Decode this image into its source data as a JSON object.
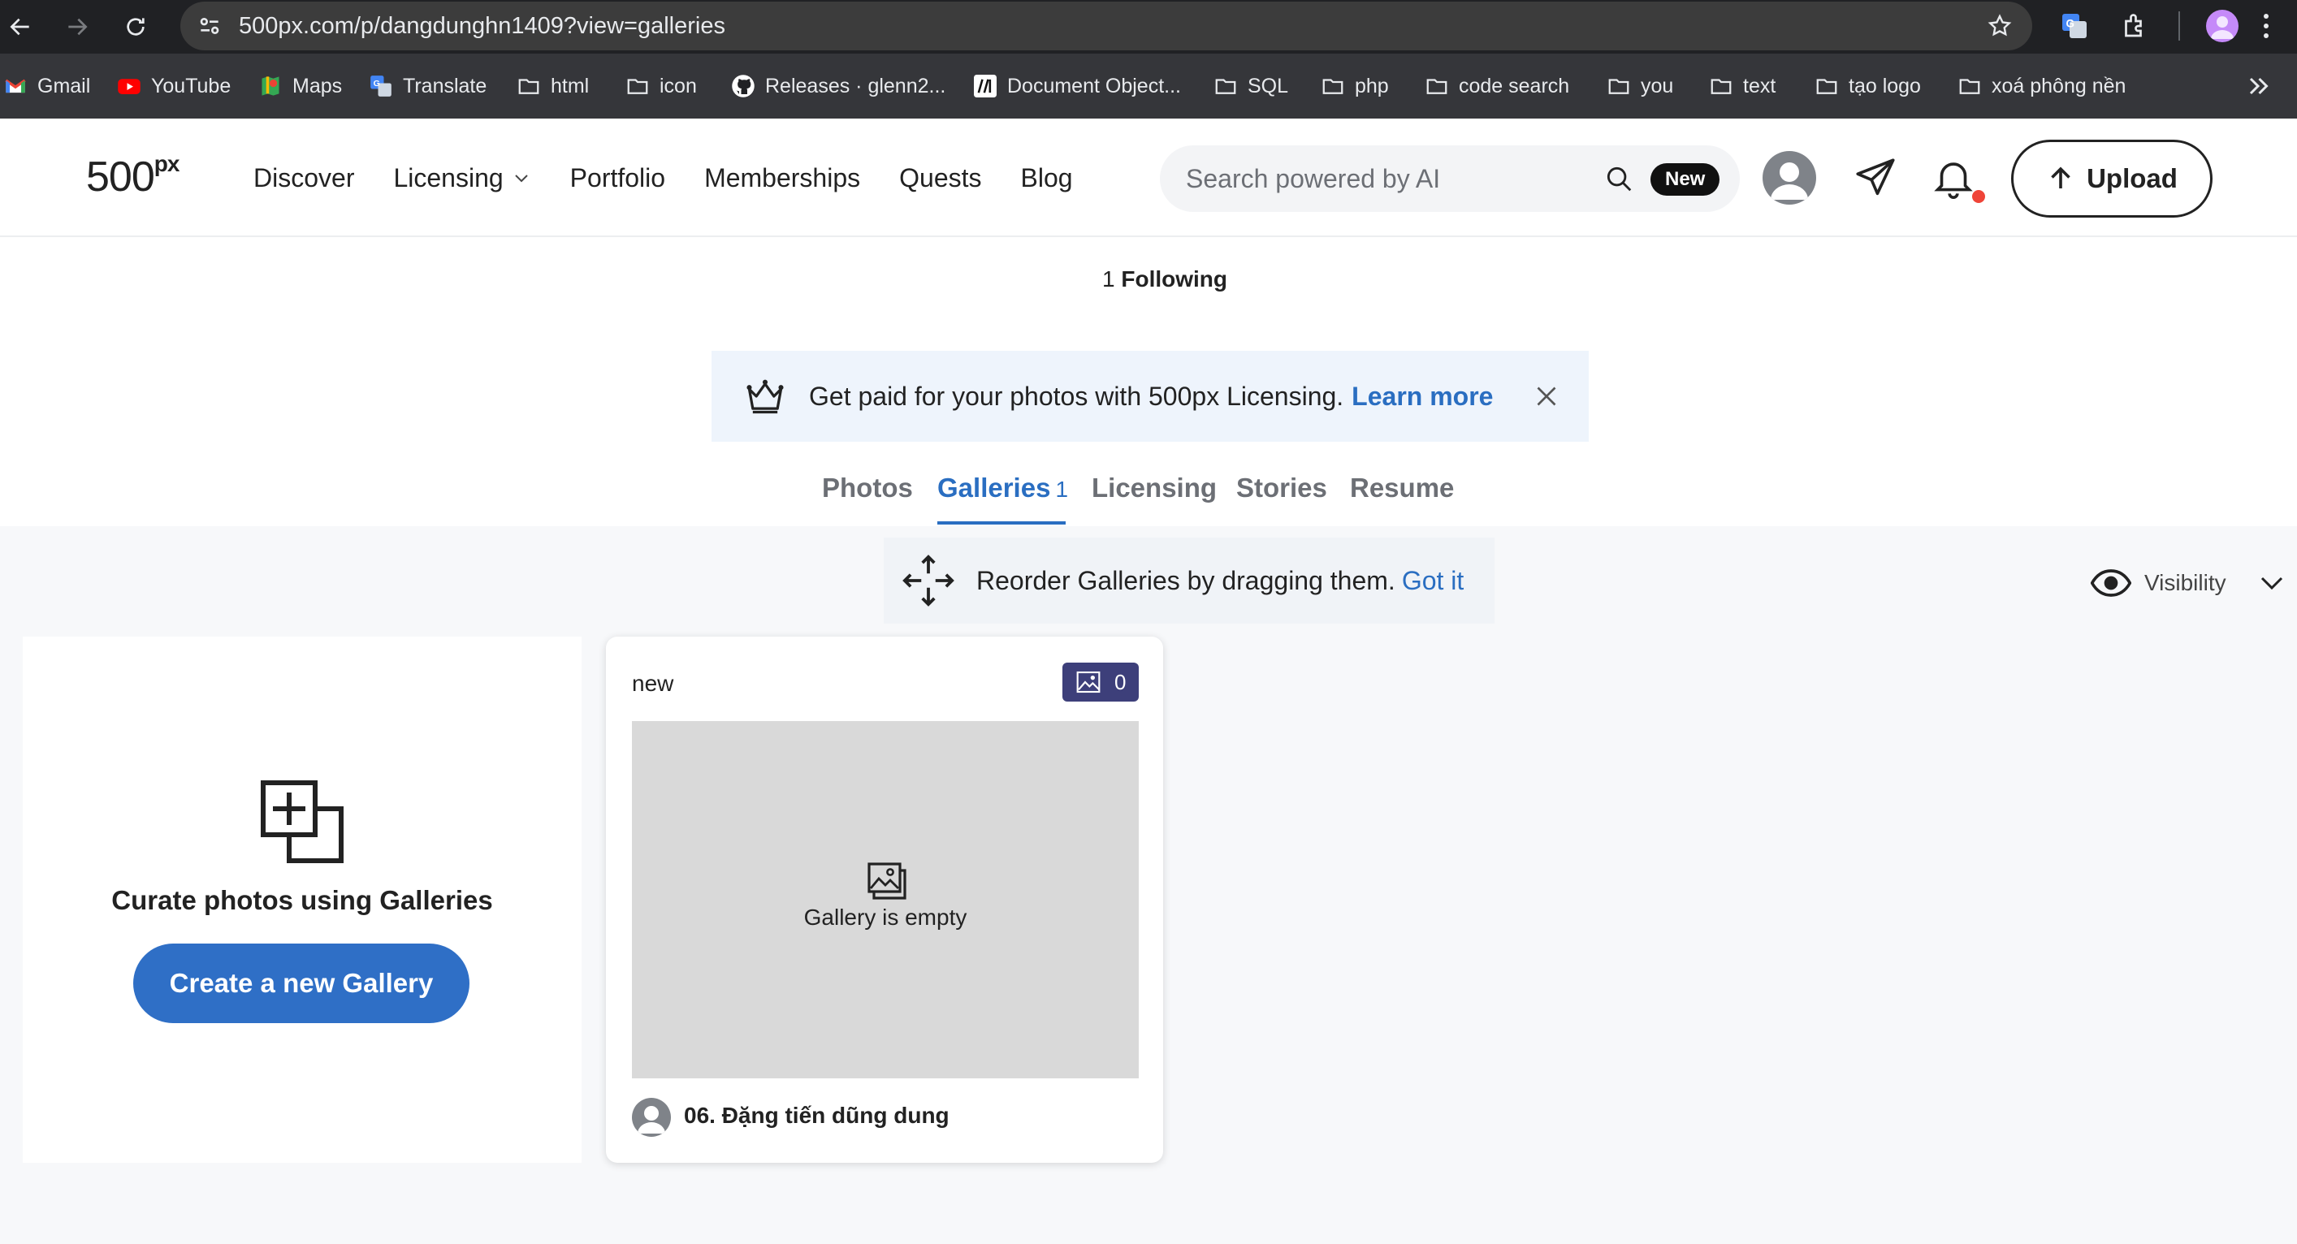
{
  "browser": {
    "url": "500px.com/p/dangdunghn1409?view=galleries",
    "bookmarks": [
      {
        "label": "Gmail",
        "icon": "gmail-icon"
      },
      {
        "label": "YouTube",
        "icon": "youtube-icon"
      },
      {
        "label": "Maps",
        "icon": "maps-icon"
      },
      {
        "label": "Translate",
        "icon": "translate-icon"
      },
      {
        "label": "html",
        "icon": "folder-icon"
      },
      {
        "label": "icon",
        "icon": "folder-icon"
      },
      {
        "label": "Releases · glenn2...",
        "icon": "github-icon"
      },
      {
        "label": "Document Object...",
        "icon": "mdn-icon"
      },
      {
        "label": "SQL",
        "icon": "folder-icon"
      },
      {
        "label": "php",
        "icon": "folder-icon"
      },
      {
        "label": "code search",
        "icon": "folder-icon"
      },
      {
        "label": "you",
        "icon": "folder-icon"
      },
      {
        "label": "text",
        "icon": "folder-icon"
      },
      {
        "label": "tạo logo",
        "icon": "folder-icon"
      },
      {
        "label": "xoá phông nền",
        "icon": "folder-icon"
      }
    ]
  },
  "header": {
    "logo": "500",
    "logo_sup": "px",
    "nav": {
      "discover": "Discover",
      "licensing": "Licensing",
      "portfolio": "Portfolio",
      "memberships": "Memberships",
      "quests": "Quests",
      "blog": "Blog"
    },
    "search_placeholder": "Search powered by AI",
    "new_badge": "New",
    "upload_label": "Upload"
  },
  "profile": {
    "following_count": "1",
    "following_label": "Following",
    "banner_text": "Get paid for your photos with 500px Licensing.",
    "banner_link": "Learn more",
    "tabs": {
      "photos": "Photos",
      "galleries": "Galleries",
      "galleries_count": "1",
      "licensing": "Licensing",
      "stories": "Stories",
      "resume": "Resume"
    }
  },
  "galleries": {
    "reorder_text": "Reorder Galleries by dragging them.",
    "reorder_link": "Got it",
    "visibility_label": "Visibility",
    "create_card": {
      "title": "Curate photos using Galleries",
      "button": "Create a new Gallery"
    },
    "items": [
      {
        "name": "new",
        "photo_count": "0",
        "empty_text": "Gallery is empty",
        "owner": "06. Đặng tiến dũng dung"
      }
    ]
  },
  "colors": {
    "accent_blue": "#2a6ec1",
    "button_blue": "#2f6fc6",
    "badge_purple": "#3d3f7a",
    "notification_red": "#ef4438"
  }
}
